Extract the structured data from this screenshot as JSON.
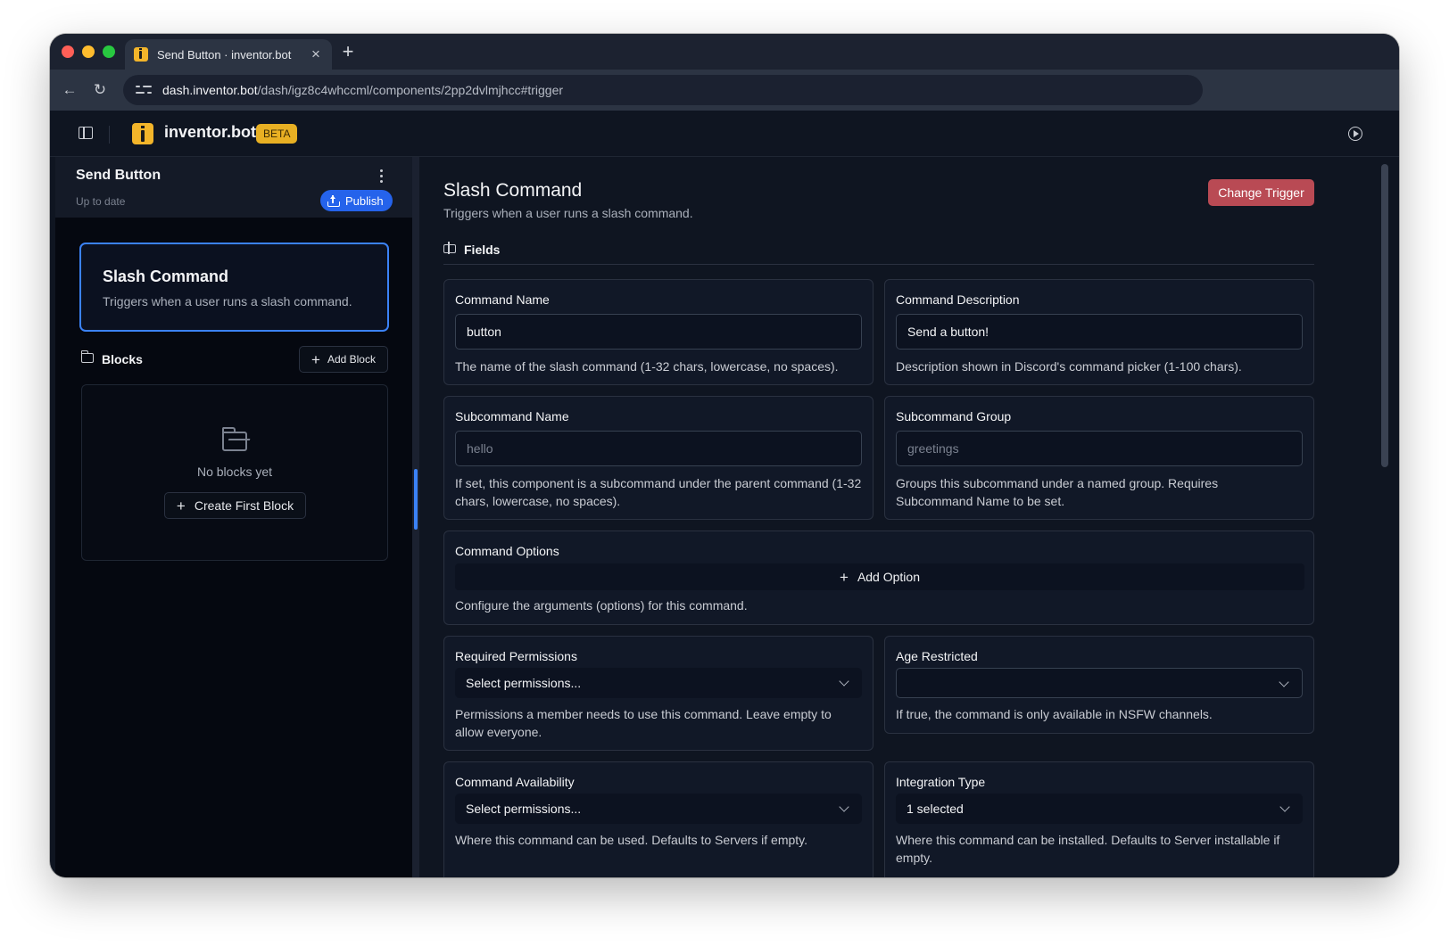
{
  "browser": {
    "tab_title": "Send Button · inventor.bot",
    "tab_close": "×",
    "new_tab": "+",
    "url_host": "dash.inventor.bot",
    "url_path": "/dash/igz8c4whccml/components/2pp2dvlmjhcc#trigger"
  },
  "header": {
    "brand": "inventor.bot",
    "badge": "BETA"
  },
  "sidebar": {
    "title": "Send Button",
    "status": "Up to date",
    "publish_label": "Publish",
    "trigger_card": {
      "title": "Slash Command",
      "description": "Triggers when a user runs a slash command."
    },
    "blocks_label": "Blocks",
    "add_block_label": "Add Block",
    "empty_text": "No blocks yet",
    "create_first_label": "Create First Block"
  },
  "main": {
    "title": "Slash Command",
    "description": "Triggers when a user runs a slash command.",
    "change_trigger_label": "Change Trigger",
    "fields_label": "Fields",
    "command_name": {
      "label": "Command Name",
      "value": "button",
      "help": "The name of the slash command (1-32 chars, lowercase, no spaces)."
    },
    "command_description": {
      "label": "Command Description",
      "value": "Send a button!",
      "help": "Description shown in Discord's command picker (1-100 chars)."
    },
    "subcommand_name": {
      "label": "Subcommand Name",
      "placeholder": "hello",
      "help": "If set, this component is a subcommand under the parent command (1-32 chars, lowercase, no spaces)."
    },
    "subcommand_group": {
      "label": "Subcommand Group",
      "placeholder": "greetings",
      "help": "Groups this subcommand under a named group. Requires Subcommand Name to be set."
    },
    "command_options": {
      "label": "Command Options",
      "add_label": "Add Option",
      "help": "Configure the arguments (options) for this command."
    },
    "required_permissions": {
      "label": "Required Permissions",
      "value": "Select permissions...",
      "help": "Permissions a member needs to use this command. Leave empty to allow everyone."
    },
    "age_restricted": {
      "label": "Age Restricted",
      "value": "",
      "help": "If true, the command is only available in NSFW channels."
    },
    "command_availability": {
      "label": "Command Availability",
      "value": "Select permissions...",
      "help": "Where this command can be used. Defaults to Servers if empty."
    },
    "integration_type": {
      "label": "Integration Type",
      "value": "1 selected",
      "help": "Where this command can be installed. Defaults to Server installable if empty."
    }
  },
  "colors": {
    "accent": "#3b82f6",
    "publish": "#2563eb",
    "change_trigger": "#b94a54",
    "beta_badge": "#e8b023"
  }
}
